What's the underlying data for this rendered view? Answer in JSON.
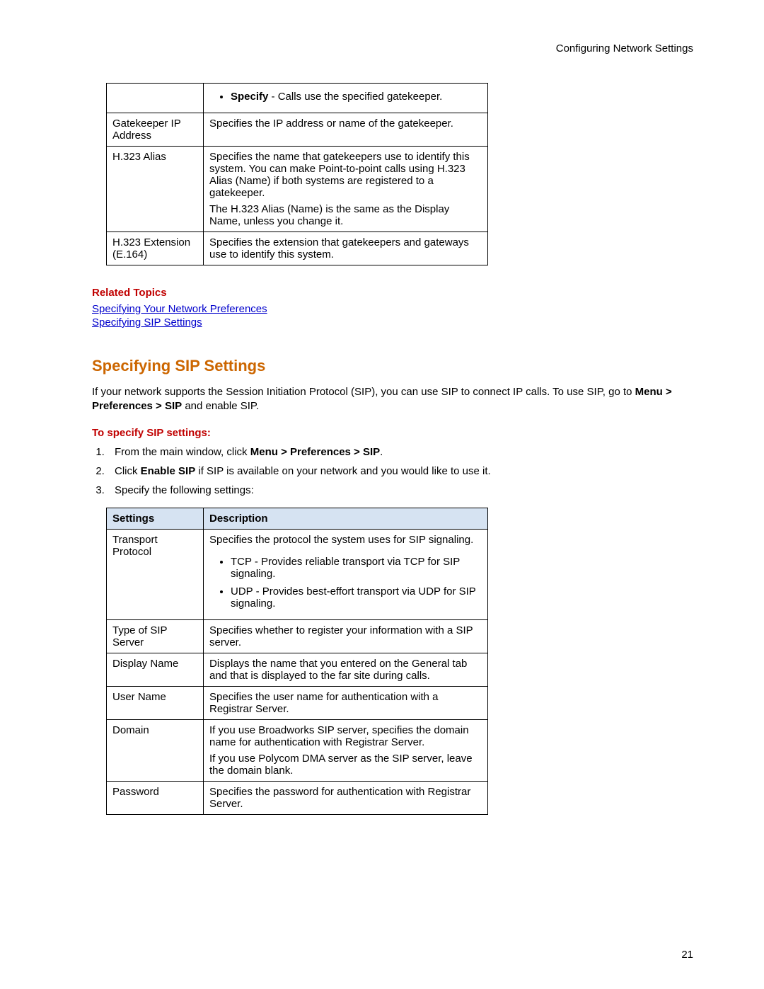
{
  "header": {
    "title": "Configuring Network Settings"
  },
  "table1": {
    "rows": [
      {
        "setting": "",
        "desc_bullet_bold": "Specify",
        "desc_bullet_rest": " - Calls use the specified gatekeeper."
      },
      {
        "setting": "Gatekeeper IP Address",
        "desc": "Specifies the IP address or name of the gatekeeper."
      },
      {
        "setting": "H.323 Alias",
        "desc_p1": "Specifies the name that gatekeepers use to identify this system. You can make Point-to-point calls using H.323 Alias (Name) if both systems are registered to a gatekeeper.",
        "desc_p2": "The H.323 Alias (Name) is the same as the Display Name, unless you change it."
      },
      {
        "setting": "H.323 Extension (E.164)",
        "desc": "Specifies the extension that gatekeepers and gateways use to identify this system."
      }
    ]
  },
  "related": {
    "heading": "Related Topics",
    "links": [
      "Specifying Your Network Preferences",
      "Specifying SIP Settings"
    ]
  },
  "section": {
    "title": "Specifying SIP Settings",
    "intro_pre": "If your network supports the Session Initiation Protocol (SIP), you can use SIP to connect IP calls. To use SIP, go to ",
    "intro_bold": "Menu > Preferences > SIP",
    "intro_post": " and enable SIP.",
    "sub": "To specify SIP settings:",
    "steps": {
      "s1_pre": "From the main window, click ",
      "s1_bold": "Menu > Preferences > SIP",
      "s1_post": ".",
      "s2_pre": "Click ",
      "s2_bold": "Enable SIP",
      "s2_post": " if SIP is available on your network and you would like to use it.",
      "s3": "Specify the following settings:"
    }
  },
  "table2": {
    "header_settings": "Settings",
    "header_desc": "Description",
    "rows": {
      "transport": {
        "setting": "Transport Protocol",
        "desc": "Specifies the protocol the system uses for SIP signaling.",
        "b1": "TCP - Provides reliable transport via TCP for SIP signaling.",
        "b2": "UDP - Provides best-effort transport via UDP for SIP signaling."
      },
      "type": {
        "setting": "Type of SIP Server",
        "desc": "Specifies whether to register your information with a SIP server."
      },
      "display": {
        "setting": "Display Name",
        "desc": "Displays the name that you entered on the General tab and that is displayed to the far site during calls."
      },
      "user": {
        "setting": "User Name",
        "desc": "Specifies the user name for authentication with a Registrar Server."
      },
      "domain": {
        "setting": "Domain",
        "desc_p1": "If you use Broadworks SIP server, specifies the domain name for authentication with Registrar Server.",
        "desc_p2": "If you use Polycom DMA server as the SIP server, leave the domain blank."
      },
      "password": {
        "setting": "Password",
        "desc": "Specifies the password for authentication with Registrar Server."
      }
    }
  },
  "page_number": "21"
}
